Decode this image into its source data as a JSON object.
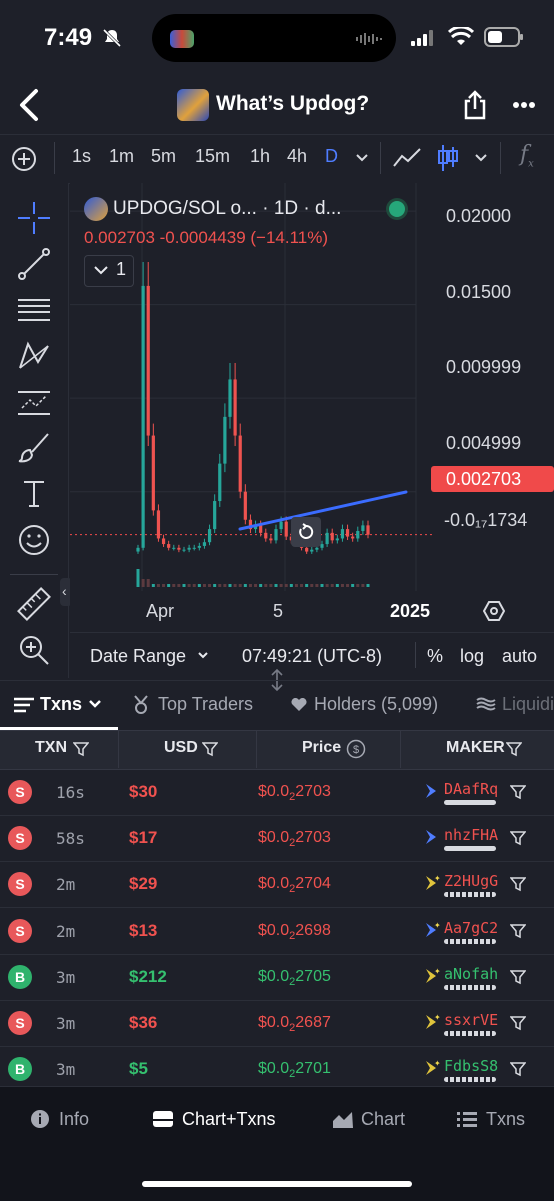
{
  "status_bar": {
    "time": "7:49"
  },
  "header": {
    "title": "What’s Updog?"
  },
  "timeframes": [
    "1s",
    "1m",
    "5m",
    "15m",
    "1h",
    "4h",
    "D"
  ],
  "active_timeframe": "D",
  "chart": {
    "symbol_title": "UPDOG/SOL o... · 1D · d...",
    "ohlc": "0.002703  -0.0004439 (−14.11%)",
    "indicator_count": "1",
    "y_ticks": [
      "0.02000",
      "0.01500",
      "0.009999",
      "0.004999",
      "-0.0₁₇1734"
    ],
    "last_price": "0.002703",
    "x_ticks": [
      "Apr",
      "5",
      "2025"
    ],
    "range_label": "Date Range",
    "clock": "07:49:21 (UTC-8)",
    "percent": "%",
    "log": "log",
    "auto": "auto"
  },
  "chart_data": {
    "type": "candlestick",
    "title": "UPDOG/SOL",
    "ylim": [
      -0.0025,
      0.0215
    ],
    "series": [
      {
        "name": "UPDOG/SOL",
        "values": [
          0.002,
          0.016,
          0.008,
          0.004,
          0.0025,
          0.0022,
          0.002,
          0.002,
          0.0019,
          0.0019,
          0.002,
          0.002,
          0.0021,
          0.0023,
          0.003,
          0.0045,
          0.0065,
          0.009,
          0.011,
          0.008,
          0.005,
          0.0035,
          0.003,
          0.0032,
          0.0028,
          0.0025,
          0.0024,
          0.003,
          0.0034,
          0.0026,
          0.0024,
          0.0022,
          0.002,
          0.0018,
          0.0019,
          0.002,
          0.0022,
          0.0028,
          0.0024,
          0.0025,
          0.003,
          0.0026,
          0.0025,
          0.0029,
          0.0032,
          0.0027
        ]
      }
    ]
  },
  "tabs": [
    "Txns",
    "Top Traders",
    "Holders (5,099)",
    "Liquidity"
  ],
  "table": {
    "headers": [
      "TXN",
      "USD",
      "Price",
      "MAKER"
    ],
    "rows": [
      {
        "type": "S",
        "age": "16s",
        "usd": "$30",
        "price_prefix": "$0.0",
        "price_sub": "2",
        "price_digits": "2703",
        "maker": "DAafRq"
      },
      {
        "type": "S",
        "age": "58s",
        "usd": "$17",
        "price_prefix": "$0.0",
        "price_sub": "2",
        "price_digits": "2703",
        "maker": "nhzFHA"
      },
      {
        "type": "S",
        "age": "2m",
        "usd": "$29",
        "price_prefix": "$0.0",
        "price_sub": "2",
        "price_digits": "2704",
        "maker": "Z2HUgG"
      },
      {
        "type": "S",
        "age": "2m",
        "usd": "$13",
        "price_prefix": "$0.0",
        "price_sub": "2",
        "price_digits": "2698",
        "maker": "Aa7gC2"
      },
      {
        "type": "B",
        "age": "3m",
        "usd": "$212",
        "price_prefix": "$0.0",
        "price_sub": "2",
        "price_digits": "2705",
        "maker": "aNofah"
      },
      {
        "type": "S",
        "age": "3m",
        "usd": "$36",
        "price_prefix": "$0.0",
        "price_sub": "2",
        "price_digits": "2687",
        "maker": "ssxrVE"
      },
      {
        "type": "B",
        "age": "3m",
        "usd": "$5",
        "price_prefix": "$0.0",
        "price_sub": "2",
        "price_digits": "2701",
        "maker": "FdbsS8"
      }
    ]
  },
  "bottom_nav": [
    "Info",
    "Chart+Txns",
    "Chart",
    "Txns"
  ],
  "colors": {
    "sell": "#f0524f",
    "buy": "#35c06f",
    "accent": "#4f7dff",
    "trendline": "#3b6cff"
  }
}
